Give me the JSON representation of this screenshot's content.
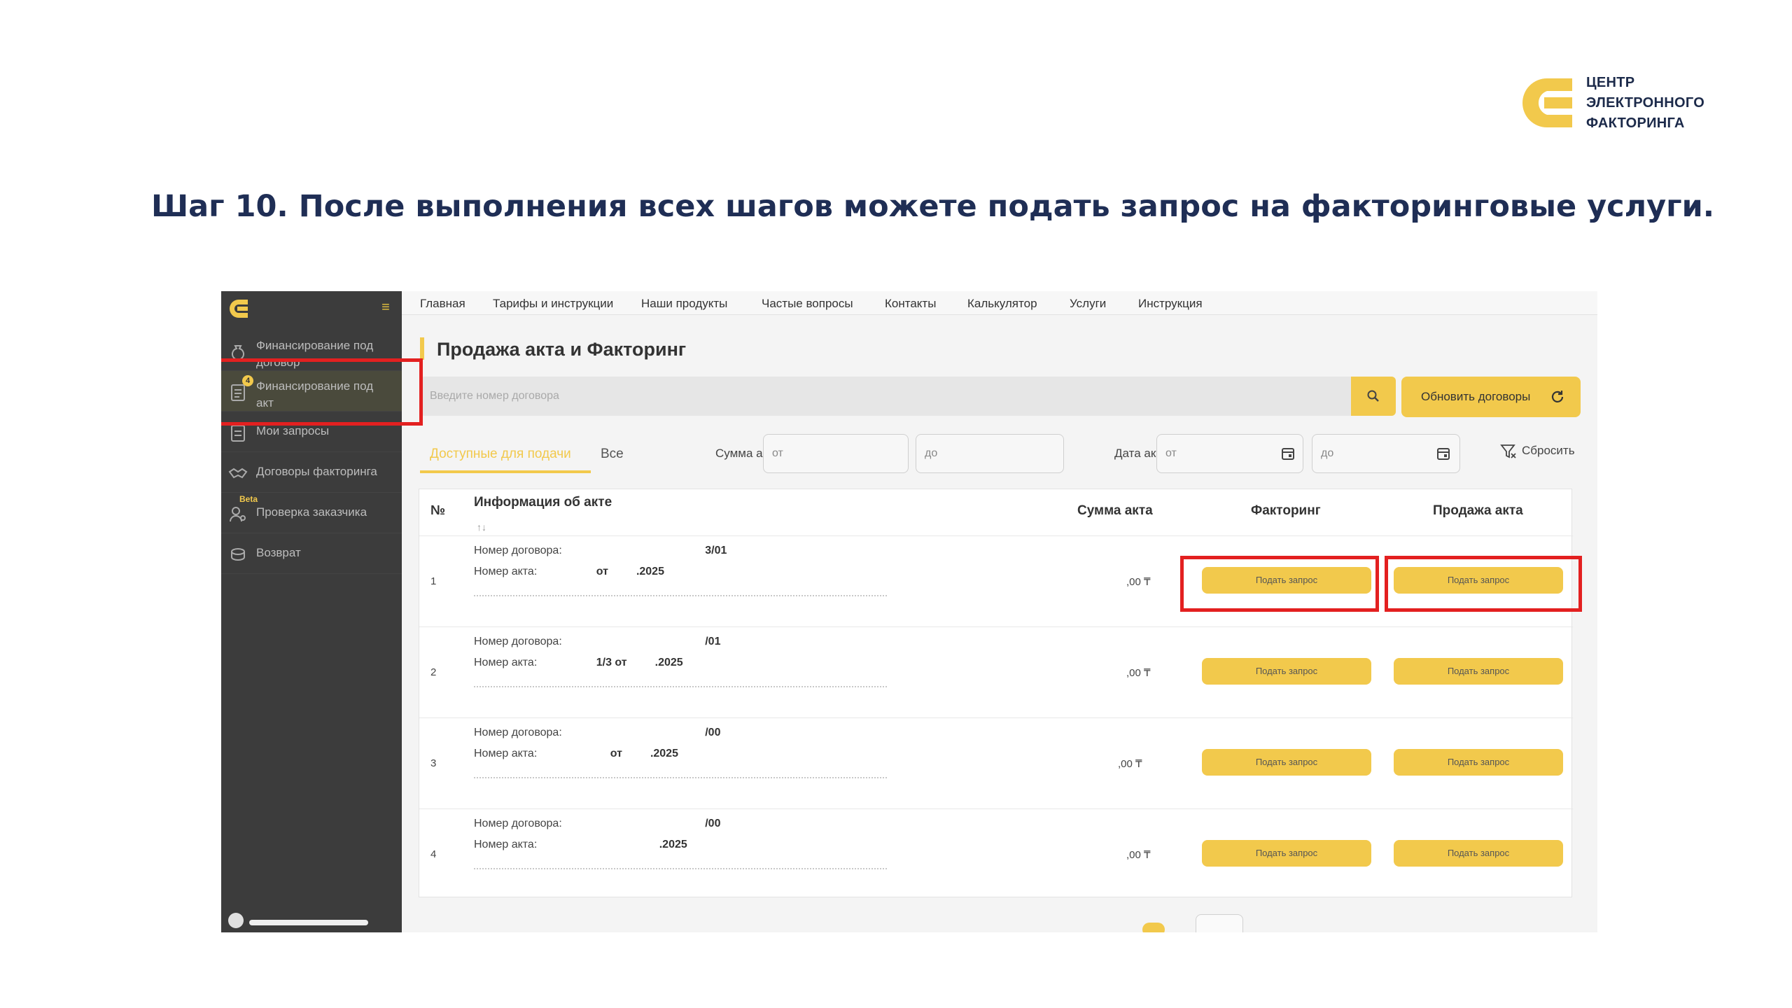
{
  "logo": {
    "lines": [
      "ЦЕНТР",
      "ЭЛЕКТРОННОГО",
      "ФАКТОРИНГА"
    ],
    "colors": {
      "yellow": "#f2c94c",
      "dark": "#1c2a4a"
    }
  },
  "slide_title": "Шаг 10.  После выполнения всех шагов можете подать запрос на факторинговые услуги.",
  "sidebar": {
    "items": [
      {
        "label": "Финансирование под договор",
        "icon": "money-bag-icon"
      },
      {
        "label": "Финансирование под акт",
        "icon": "document-icon",
        "badge": "4"
      },
      {
        "label": "Мои запросы",
        "icon": "list-icon"
      },
      {
        "label": "Договоры факторинга",
        "icon": "handshake-icon"
      },
      {
        "label": "Проверка заказчика",
        "icon": "user-search-icon",
        "tag": "Beta"
      },
      {
        "label": "Возврат",
        "icon": "coins-icon"
      }
    ]
  },
  "topnav": [
    "Главная",
    "Тарифы и инструкции",
    "Наши продукты",
    "Частые вопросы",
    "Контакты",
    "Калькулятор",
    "Услуги",
    "Инструкция"
  ],
  "page_title": "Продажа акта и Факторинг",
  "search": {
    "placeholder": "Введите номер договора"
  },
  "refresh_label": "Обновить договоры",
  "tabs": {
    "available": "Доступные для подачи",
    "all": "Все"
  },
  "filters": {
    "sum_label": "Сумма акта",
    "sum_from": "от",
    "sum_to": "до",
    "date_label": "Дата акта",
    "date_from": "от",
    "date_to": "до",
    "reset_label": "Сбросить"
  },
  "table": {
    "headers": {
      "num": "№",
      "info": "Информация об акте",
      "sort": "↑↓",
      "sum": "Сумма акта",
      "factoring": "Факторинг",
      "sale": "Продажа акта"
    },
    "rows": [
      {
        "num": "1",
        "contract": "Номер договора: ",
        "contract_tail": "3/01",
        "act": "Номер акта: ",
        "act_mid": "от",
        "act_tail": ".2025",
        "sum": ",00 ₸"
      },
      {
        "num": "2",
        "contract": "Номер договора: ",
        "contract_tail": "/01",
        "act": "Номер акта: ",
        "act_mid": "1/3 от",
        "act_tail": ".2025",
        "sum": ",00 ₸"
      },
      {
        "num": "3",
        "contract": "Номер договора: ",
        "contract_tail": "/00",
        "act": "Номер акта: ",
        "act_mid": "от",
        "act_tail": ".2025",
        "sum": ",00 ₸"
      },
      {
        "num": "4",
        "contract": "Номер договора: ",
        "contract_tail": "/00",
        "act": "Номер акта: ",
        "act_mid": "",
        "act_tail": ".2025",
        "sum": ",00 ₸"
      }
    ],
    "button_label": "Подать запрос"
  },
  "highlight_color": "#e32020"
}
